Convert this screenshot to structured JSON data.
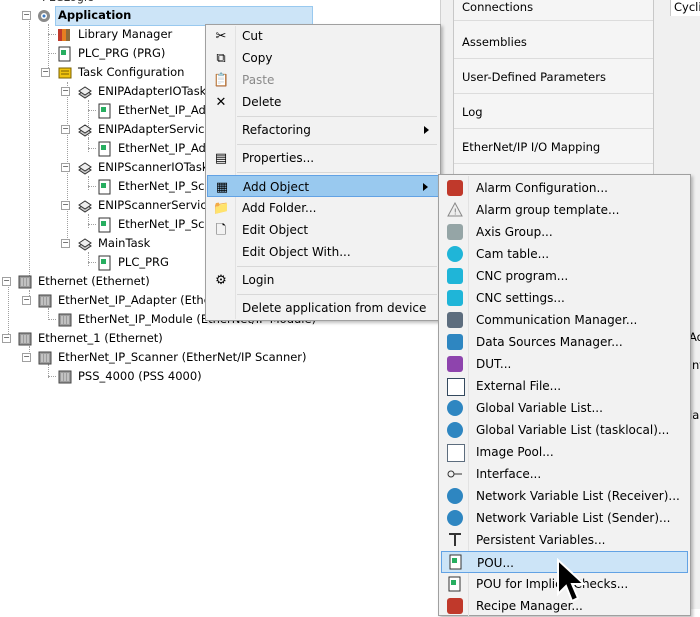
{
  "tree": {
    "nodes": [
      {
        "label": "Application",
        "name": "tree-node-application"
      },
      {
        "label": "Library Manager",
        "name": "tree-node-library-manager"
      },
      {
        "label": "PLC_PRG (PRG)",
        "name": "tree-node-plc-prg"
      },
      {
        "label": "Task Configuration",
        "name": "tree-node-task-configuration"
      },
      {
        "label": "ENIPAdapterIOTask",
        "name": "tree-node-enip-adapter-io-task"
      },
      {
        "label": "EtherNet_IP_Adap",
        "name": "tree-node-ethernet-ip-adapter-call-1"
      },
      {
        "label": "ENIPAdapterServiceTa",
        "name": "tree-node-enip-adapter-service-task"
      },
      {
        "label": "EtherNet_IP_Adap",
        "name": "tree-node-ethernet-ip-adapter-call-2"
      },
      {
        "label": "ENIPScannerIOTask",
        "name": "tree-node-enip-scanner-io-task"
      },
      {
        "label": "EtherNet_IP_Scan",
        "name": "tree-node-ethernet-ip-scanner-call-1"
      },
      {
        "label": "ENIPScannerServiceTa",
        "name": "tree-node-enip-scanner-service-task"
      },
      {
        "label": "EtherNet_IP_Scan",
        "name": "tree-node-ethernet-ip-scanner-call-2"
      },
      {
        "label": "MainTask",
        "name": "tree-node-main-task"
      },
      {
        "label": "PLC_PRG",
        "name": "tree-node-main-task-plc-prg"
      },
      {
        "label": "Ethernet (Ethernet)",
        "name": "tree-node-ethernet"
      },
      {
        "label": "EtherNet_IP_Adapter (EtherN",
        "name": "tree-node-ethernet-ip-adapter"
      },
      {
        "label": "EtherNet_IP_Module (EtherNet/IP Module)",
        "name": "tree-node-ethernet-ip-module"
      },
      {
        "label": "Ethernet_1 (Ethernet)",
        "name": "tree-node-ethernet-1"
      },
      {
        "label": "EtherNet_IP_Scanner (EtherNet/IP Scanner)",
        "name": "tree-node-ethernet-ip-scanner"
      },
      {
        "label": "PSS_4000 (PSS 4000)",
        "name": "tree-node-pss-4000"
      }
    ]
  },
  "right_panel": {
    "tabs": [
      "Connections",
      "Assemblies",
      "User-Defined Parameters",
      "Log",
      "EtherNet/IP I/O Mapping"
    ],
    "cyclic_label": "Cyclic",
    "fragments": [
      "Ad",
      "nf",
      "lar"
    ]
  },
  "context_menu": {
    "items": [
      {
        "label": "Cut",
        "icon": "scissors-icon"
      },
      {
        "label": "Copy",
        "icon": "copy-icon"
      },
      {
        "label": "Paste",
        "icon": "paste-icon",
        "disabled": true
      },
      {
        "label": "Delete",
        "icon": "delete-icon"
      },
      {
        "label": "Refactoring",
        "submenu": true
      },
      {
        "label": "Properties...",
        "icon": "properties-icon"
      },
      {
        "label": "Add Object",
        "icon": "add-object-icon",
        "submenu": true,
        "highlighted": true
      },
      {
        "label": "Add Folder...",
        "icon": "folder-icon"
      },
      {
        "label": "Edit Object",
        "icon": "edit-object-icon"
      },
      {
        "label": "Edit Object With..."
      },
      {
        "label": "Login",
        "icon": "login-icon"
      },
      {
        "label": "Delete application from device"
      }
    ]
  },
  "add_object_submenu": {
    "items": [
      {
        "label": "Alarm Configuration...",
        "icon": "alarm-configuration-icon",
        "color": "#c0392b"
      },
      {
        "label": "Alarm group template...",
        "icon": "warning-triangle-icon",
        "color": "#9aa0a6"
      },
      {
        "label": "Axis Group...",
        "icon": "axis-group-icon",
        "color": "#7f8c8d"
      },
      {
        "label": "Cam table...",
        "icon": "cam-table-icon",
        "color": "#1fb5d8"
      },
      {
        "label": "CNC program...",
        "icon": "cnc-program-icon",
        "color": "#1fb5d8"
      },
      {
        "label": "CNC settings...",
        "icon": "cnc-settings-icon",
        "color": "#1fb5d8"
      },
      {
        "label": "Communication Manager...",
        "icon": "communication-manager-icon",
        "color": "#5d6d7e"
      },
      {
        "label": "Data Sources Manager...",
        "icon": "data-sources-manager-icon",
        "color": "#2e86c1"
      },
      {
        "label": "DUT...",
        "icon": "dut-icon",
        "color": "#8e44ad"
      },
      {
        "label": "External File...",
        "icon": "external-file-icon",
        "color": "#34495e"
      },
      {
        "label": "Global Variable List...",
        "icon": "globe-icon",
        "color": "#2e86c1"
      },
      {
        "label": "Global Variable List (tasklocal)...",
        "icon": "globe-tasklocal-icon",
        "color": "#2e86c1"
      },
      {
        "label": "Image Pool...",
        "icon": "image-pool-icon",
        "color": "#5d6d7e"
      },
      {
        "label": "Interface...",
        "icon": "interface-icon",
        "color": "#333333"
      },
      {
        "label": "Network Variable List (Receiver)...",
        "icon": "globe-receiver-icon",
        "color": "#2e86c1"
      },
      {
        "label": "Network Variable List (Sender)...",
        "icon": "globe-sender-icon",
        "color": "#2e86c1"
      },
      {
        "label": "Persistent Variables...",
        "icon": "persistent-variables-icon",
        "color": "#333333"
      },
      {
        "label": "POU...",
        "icon": "pou-icon",
        "color": "#27ae60",
        "highlighted": true
      },
      {
        "label": "POU for Implicit Checks...",
        "icon": "pou-implicit-checks-icon",
        "color": "#27ae60"
      },
      {
        "label": "Recipe Manager...",
        "icon": "recipe-manager-icon",
        "color": "#c0392b"
      }
    ]
  }
}
